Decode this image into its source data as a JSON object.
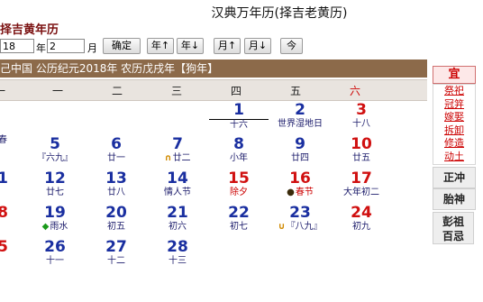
{
  "app": {
    "title": "汉典万年历(择吉老黄历)",
    "subtitle": "择吉黄年历"
  },
  "controls": {
    "year_value": "18",
    "year_unit": "年",
    "month_value": "2",
    "month_unit": "月",
    "confirm_label": "确定",
    "prev_year_label": "年↑",
    "next_year_label": "年↓",
    "prev_month_label": "月↑",
    "next_month_label": "月↓",
    "today_label": "今"
  },
  "info_bar": "己中国 公历纪元2018年 农历戊戌年【狗年】",
  "weekdays": [
    "一",
    "一",
    "二",
    "三",
    "四",
    "五",
    "六"
  ],
  "days": [
    {
      "num": "1",
      "sub": "十六",
      "row": 0,
      "col": 4
    },
    {
      "num": "2",
      "sub": "世界湿地日",
      "row": 0,
      "col": 5
    },
    {
      "num": "3",
      "sub": "十八",
      "row": 0,
      "col": 6,
      "weekend": true
    },
    {
      "num": "",
      "sub": "春",
      "row": 1,
      "col": 0
    },
    {
      "num": "5",
      "sub": "『六九』",
      "row": 1,
      "col": 1
    },
    {
      "num": "6",
      "sub": "廿一",
      "row": 1,
      "col": 2
    },
    {
      "num": "7",
      "sub": "廿二",
      "row": 1,
      "col": 3,
      "mark": "∩",
      "mark_color": "orange"
    },
    {
      "num": "8",
      "sub": "小年",
      "row": 1,
      "col": 4
    },
    {
      "num": "9",
      "sub": "廿四",
      "row": 1,
      "col": 5
    },
    {
      "num": "10",
      "sub": "廿五",
      "row": 1,
      "col": 6,
      "weekend": true
    },
    {
      "num": "1",
      "sub": "",
      "row": 2,
      "col": 0
    },
    {
      "num": "12",
      "sub": "廿七",
      "row": 2,
      "col": 1
    },
    {
      "num": "13",
      "sub": "廿八",
      "row": 2,
      "col": 2
    },
    {
      "num": "14",
      "sub": "情人节",
      "row": 2,
      "col": 3
    },
    {
      "num": "15",
      "sub": "除夕",
      "row": 2,
      "col": 4,
      "weekend": true,
      "subred": true
    },
    {
      "num": "16",
      "sub": "春节",
      "row": 2,
      "col": 5,
      "weekend": true,
      "subred": true,
      "mark": "●",
      "mark_color": "dark"
    },
    {
      "num": "17",
      "sub": "大年初二",
      "row": 2,
      "col": 6,
      "weekend": true
    },
    {
      "num": "8",
      "sub": "",
      "row": 3,
      "col": 0,
      "weekend": true
    },
    {
      "num": "19",
      "sub": "雨水",
      "row": 3,
      "col": 1,
      "mark": "◆",
      "mark_color": "green"
    },
    {
      "num": "20",
      "sub": "初五",
      "row": 3,
      "col": 2
    },
    {
      "num": "21",
      "sub": "初六",
      "row": 3,
      "col": 3
    },
    {
      "num": "22",
      "sub": "初七",
      "row": 3,
      "col": 4
    },
    {
      "num": "23",
      "sub": "『八九』",
      "row": 3,
      "col": 5,
      "mark": "∪",
      "mark_color": "orange"
    },
    {
      "num": "24",
      "sub": "初九",
      "row": 3,
      "col": 6,
      "weekend": true
    },
    {
      "num": "5",
      "sub": "",
      "row": 4,
      "col": 0,
      "weekend": true
    },
    {
      "num": "26",
      "sub": "十一",
      "row": 4,
      "col": 1
    },
    {
      "num": "27",
      "sub": "十二",
      "row": 4,
      "col": 2
    },
    {
      "num": "28",
      "sub": "十三",
      "row": 4,
      "col": 3
    }
  ],
  "side": {
    "yi_label": "宜",
    "yi_items": [
      "祭祀",
      "冠笄",
      "嫁娶",
      "拆卸",
      "修造",
      "动土"
    ],
    "chong_label": "正冲",
    "taishen_label": "胎神",
    "pengzu_line1": "彭祖",
    "pengzu_line2": "百忌"
  }
}
